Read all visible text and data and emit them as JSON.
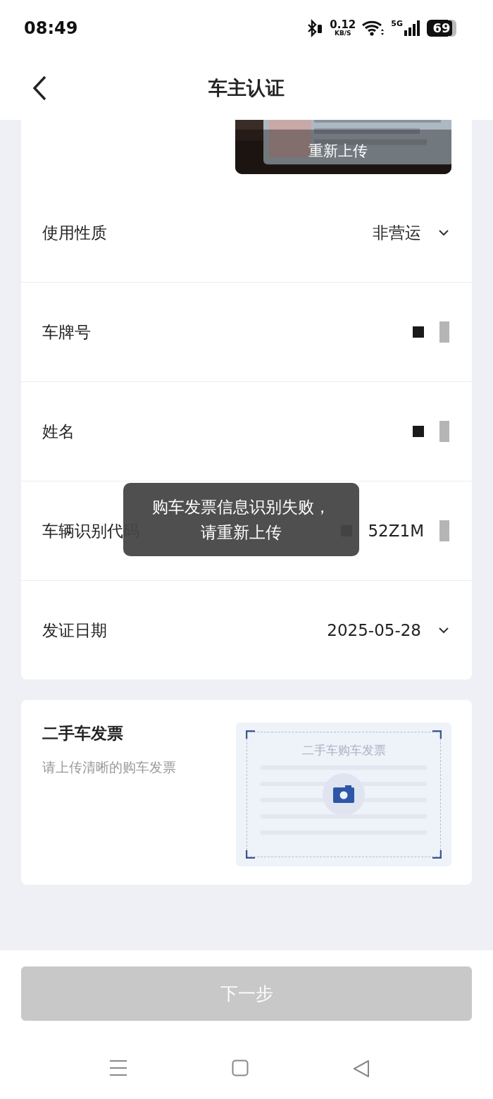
{
  "status_bar": {
    "time": "08:49",
    "net_speed": "0.12",
    "net_unit": "KB/S",
    "network": "5G",
    "battery": "69"
  },
  "header": {
    "title": "车主认证"
  },
  "license_photo": {
    "kind": "picture",
    "action": "重新上传"
  },
  "fields": [
    {
      "label": "使用性质",
      "value": "非营运",
      "kind": "select"
    },
    {
      "label": "车牌号",
      "kind": "text",
      "redacted": true
    },
    {
      "label": "姓名",
      "kind": "text",
      "redacted": true
    },
    {
      "label": "车辆识别代码",
      "value": "52Z1M",
      "kind": "text",
      "redacted": true
    },
    {
      "label": "发证日期",
      "value": "2025-05-28",
      "kind": "select"
    }
  ],
  "invoice": {
    "title": "二手车发票",
    "hint": "请上传清晰的购车发票",
    "sample_title": "二手车购车发票"
  },
  "toast": {
    "text": "购车发票信息识别失败，请重新上传"
  },
  "next_button": {
    "label": "下一步",
    "disabled": true
  }
}
